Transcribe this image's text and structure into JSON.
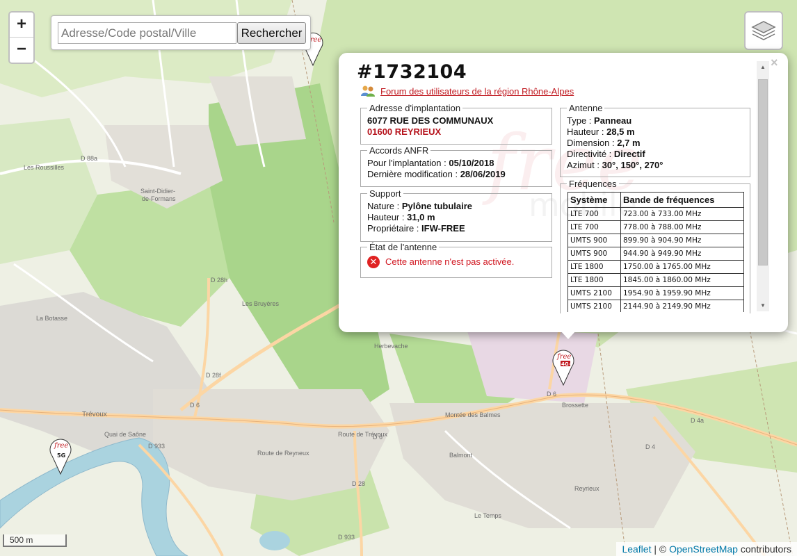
{
  "zoom": {
    "in": "+",
    "out": "−"
  },
  "search": {
    "placeholder": "Adresse/Code postal/Ville",
    "button": "Rechercher"
  },
  "map_labels": {
    "saint_didier": "Saint-Didier-de-Formans",
    "saint_didier_a": "Saint-Didier-",
    "saint_didier_b": "de-Formans",
    "trevoux": "Trévoux",
    "reyrieux": "Reyrieux",
    "les_bruyeres": "Les Bruyères",
    "balmont": "Balmont",
    "le_temps": "Le Temps",
    "brossette": "Brossette",
    "les_rousilles": "Les Roussilles",
    "herbevache": "Herbevache",
    "la_botasse": "La Botasse",
    "d6": "D 6",
    "d28": "D 28",
    "d28h": "D 28h",
    "d933": "D 933",
    "d4": "D 4",
    "d4a": "D 4a",
    "d28f": "D 28f",
    "d88a": "D 88a",
    "route_reyneux": "Route de Reyneux",
    "montee_balmes": "Montée des Balmes",
    "route_trevoux": "Route de Trévoux",
    "quai_saone": "Quai de Saône"
  },
  "popup": {
    "title": "#1732104",
    "close": "×",
    "forum_link": "Forum des utilisateurs de la région Rhône-Alpes",
    "watermark": "free",
    "watermark2": "mobile",
    "address": {
      "legend": "Adresse d'implantation",
      "street": "6077 RUE DES COMMUNAUX",
      "city": "01600 REYRIEUX"
    },
    "anfr": {
      "legend": "Accords ANFR",
      "impl_label": "Pour l'implantation :",
      "impl_value": "05/10/2018",
      "modif_label": "Dernière modification :",
      "modif_value": "28/06/2019"
    },
    "support": {
      "legend": "Support",
      "nature_label": "Nature :",
      "nature_value": "Pylône tubulaire",
      "height_label": "Hauteur :",
      "height_value": "31,0 m",
      "owner_label": "Propriétaire :",
      "owner_value": "IFW-FREE"
    },
    "state": {
      "legend": "État de l'antenne",
      "message": "Cette antenne n'est pas activée."
    },
    "antenna": {
      "legend": "Antenne",
      "type_label": "Type :",
      "type_value": "Panneau",
      "height_label": "Hauteur :",
      "height_value": "28,5 m",
      "dim_label": "Dimension :",
      "dim_value": "2,7 m",
      "dir_label": "Directivité :",
      "dir_value": "Directif",
      "azimut_label": "Azimut :",
      "azimut_value": "30°, 150°, 270°"
    },
    "freq": {
      "legend": "Fréquences",
      "headers": [
        "Système",
        "Bande de fréquences"
      ],
      "rows": [
        [
          "LTE 700",
          "723.00 à 733.00 MHz"
        ],
        [
          "LTE 700",
          "778.00 à 788.00 MHz"
        ],
        [
          "UMTS 900",
          "899.90 à 904.90 MHz"
        ],
        [
          "UMTS 900",
          "944.90 à 949.90 MHz"
        ],
        [
          "LTE 1800",
          "1750.00 à 1765.00 MHz"
        ],
        [
          "LTE 1800",
          "1845.00 à 1860.00 MHz"
        ],
        [
          "UMTS 2100",
          "1954.90 à 1959.90 MHz"
        ],
        [
          "UMTS 2100",
          "2144.90 à 2149.90 MHz"
        ]
      ]
    }
  },
  "markers": {
    "free": "free",
    "mobile": "mobile",
    "tag_4g": "4G+",
    "tag_5g": "5G"
  },
  "scale": "500 m",
  "attribution": {
    "leaflet": "Leaflet",
    "sep": " | © ",
    "osm": "OpenStreetMap",
    "suffix": " contributors"
  },
  "colors": {
    "brand_red": "#c0181f",
    "link_blue": "#0078a8",
    "error_red": "#e02222"
  }
}
